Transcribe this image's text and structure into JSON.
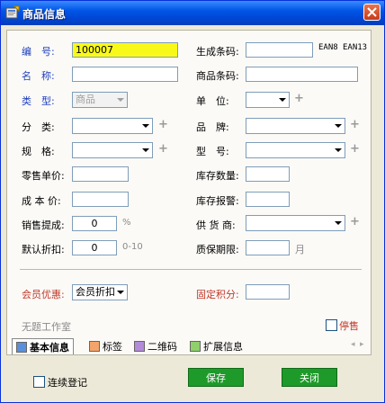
{
  "window": {
    "title": "商品信息"
  },
  "form": {
    "code": {
      "label": "编　号:",
      "value": "100007"
    },
    "barcode_gen": {
      "label": "生成条码:",
      "value": "",
      "ean8": "EAN8",
      "ean13": "EAN13"
    },
    "name": {
      "label": "名　称:",
      "value": ""
    },
    "product_barcode": {
      "label": "商品条码:",
      "value": ""
    },
    "type": {
      "label": "类　型:",
      "value": "商品"
    },
    "unit": {
      "label": "单　位:",
      "value": ""
    },
    "category": {
      "label": "分　类:",
      "value": ""
    },
    "brand": {
      "label": "品　牌:",
      "value": ""
    },
    "spec": {
      "label": "规　格:",
      "value": ""
    },
    "model": {
      "label": "型　号:",
      "value": ""
    },
    "retail_price": {
      "label": "零售单价:",
      "value": ""
    },
    "stock_qty": {
      "label": "库存数量:",
      "value": ""
    },
    "cost_price": {
      "label": "成 本 价:",
      "value": ""
    },
    "stock_alert": {
      "label": "库存报警:",
      "value": ""
    },
    "commission": {
      "label": "销售提成:",
      "value": "0",
      "unit": "%"
    },
    "supplier": {
      "label": "供 货 商:",
      "value": ""
    },
    "discount": {
      "label": "默认折扣:",
      "value": "0",
      "hint": "0-10"
    },
    "shelf_life": {
      "label": "质保期限:",
      "value": "",
      "unit": "月"
    },
    "member_discount": {
      "label": "会员优惠:",
      "value": "会员折扣"
    },
    "fixed_points": {
      "label": "固定积分:",
      "value": ""
    },
    "studio": {
      "label": "无题工作室"
    },
    "discontinued": {
      "label": "停售"
    }
  },
  "tabs": [
    {
      "label": "基本信息",
      "color": "#5b8fd9"
    },
    {
      "label": "标签",
      "color": "#f4a46a"
    },
    {
      "label": "二维码",
      "color": "#b38bd9"
    },
    {
      "label": "扩展信息",
      "color": "#8fd06b"
    }
  ],
  "footer": {
    "continuous_label": "连续登记",
    "save_label": "保存",
    "close_label": "关闭"
  }
}
